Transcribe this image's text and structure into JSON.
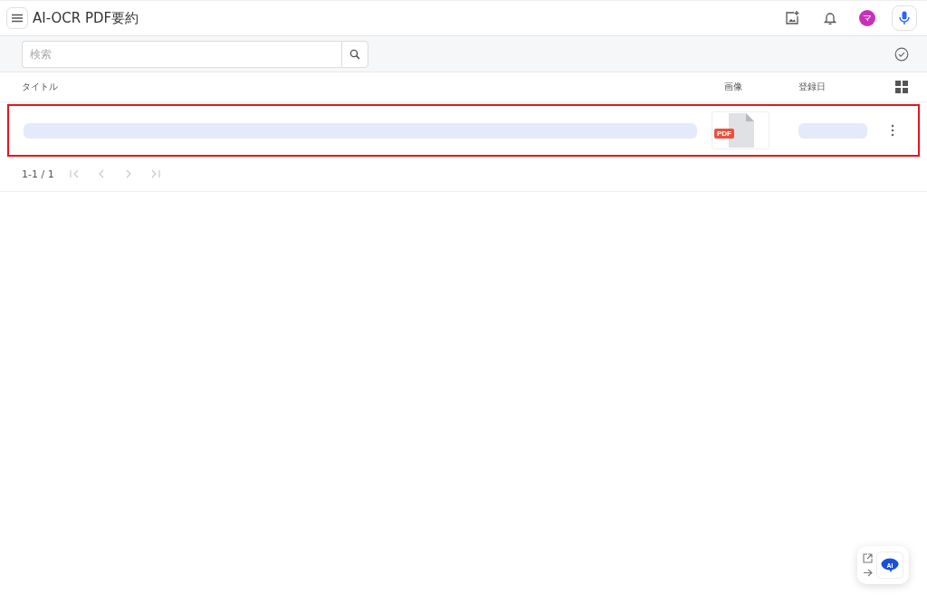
{
  "header": {
    "title": "AI-OCR PDF要約",
    "avatar": "マ"
  },
  "search": {
    "placeholder": "検索"
  },
  "table": {
    "columns": [
      "タイトル",
      "画像",
      "登録日"
    ],
    "rows": [
      {
        "loading": true,
        "thumbnail_label": "PDF",
        "highlighted": true
      }
    ]
  },
  "pagination": {
    "range": "1-1 / 1"
  },
  "assistant": {
    "badge": "AI"
  }
}
